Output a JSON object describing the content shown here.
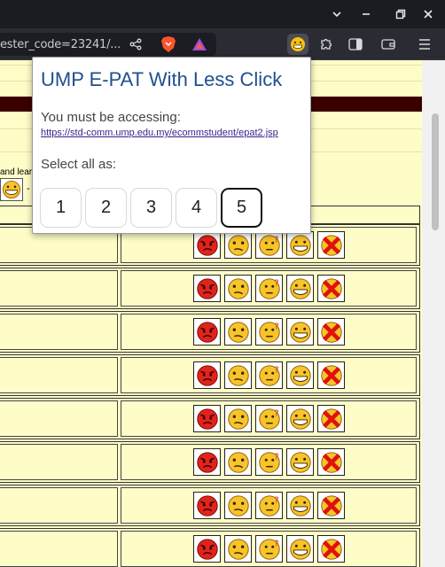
{
  "browser": {
    "url": "ester_code=23241/...",
    "window_controls": [
      "chevron-down-icon",
      "minimize-icon",
      "restore-icon",
      "close-icon"
    ]
  },
  "popup": {
    "title": "UMP E-PAT With Less Click",
    "accessing_label": "You must be accessing:",
    "accessing_url": "https://std-comm.ump.edu.my/ecommstudent/epat2.jsp",
    "select_label": "Select all as:",
    "options": [
      "1",
      "2",
      "3",
      "4",
      "5"
    ],
    "selected": "5"
  },
  "page": {
    "side_text": "and lear",
    "dash": "- ."
  },
  "colors": {
    "page_bg": "#fffdc7",
    "maroon_bar": "#3a0000",
    "popup_title": "#1f4f8f",
    "link": "#3a1f8a"
  }
}
